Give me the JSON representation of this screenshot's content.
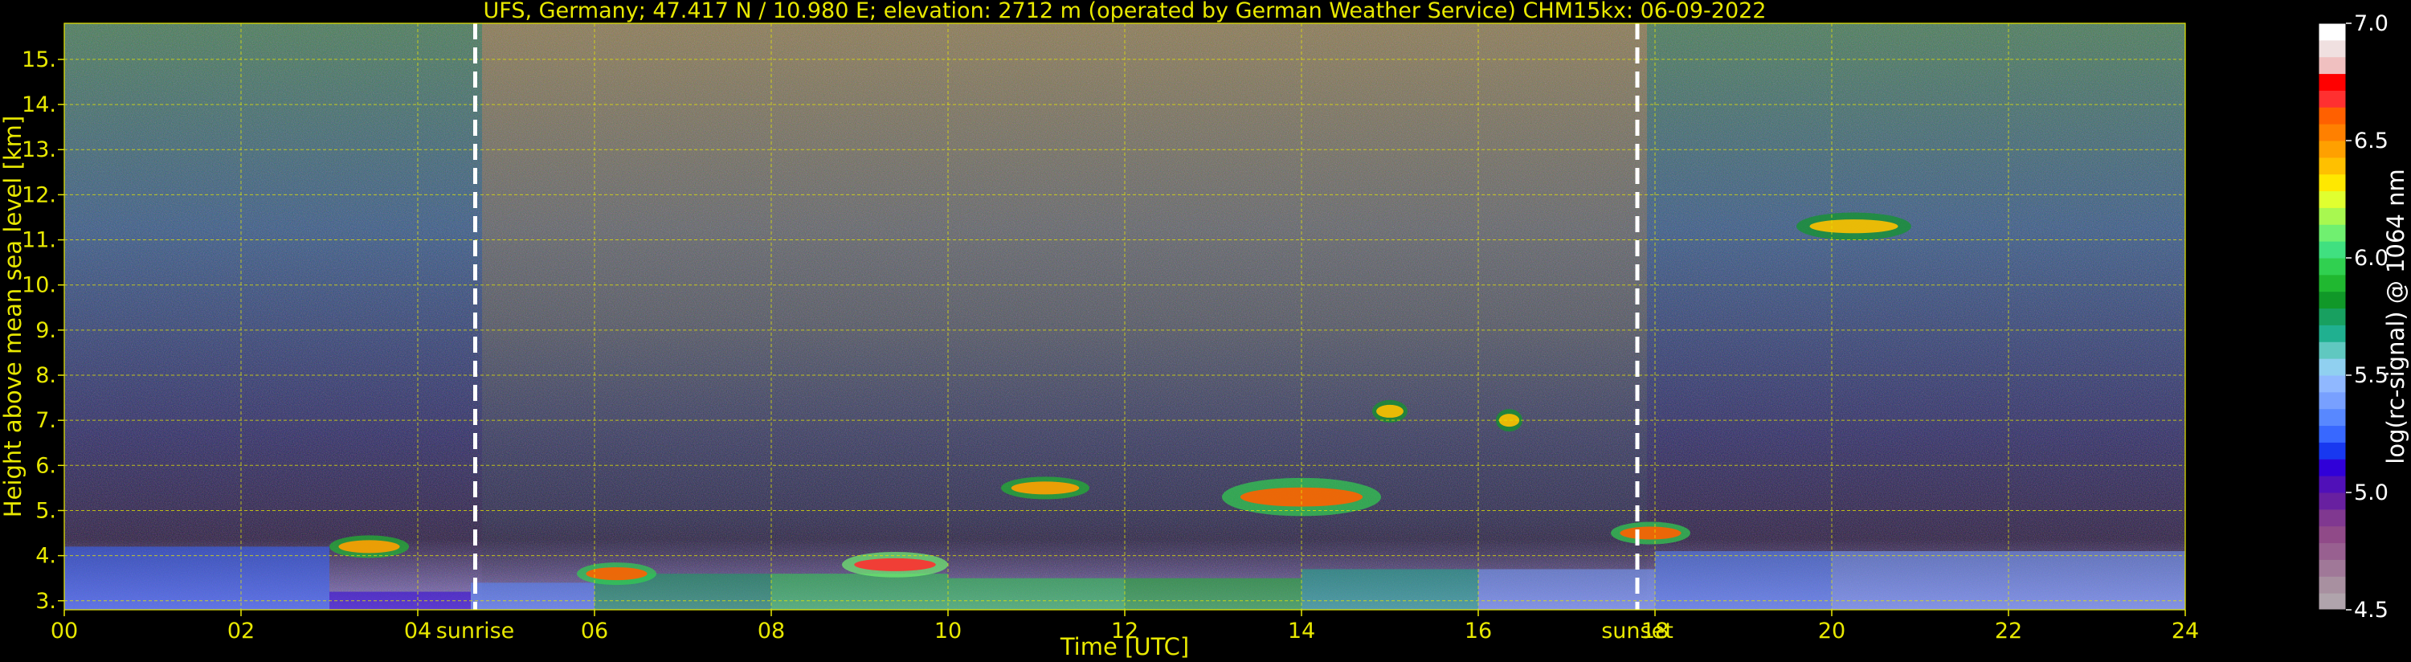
{
  "chart_data": {
    "type": "heatmap",
    "title": "UFS, Germany; 47.417 N / 10.980 E; elevation: 2712 m  (operated by German Weather Service)     CHM15kx: 06-09-2022",
    "xlabel": "Time [UTC]",
    "ylabel": "Height above mean sea level [km]",
    "xlim": [
      0,
      24
    ],
    "ylim": [
      2.8,
      15.8
    ],
    "x_ticks": [
      "00",
      "02",
      "04",
      "06",
      "08",
      "10",
      "12",
      "14",
      "16",
      "18",
      "20",
      "22",
      "24"
    ],
    "y_ticks": [
      "3.",
      "4.",
      "5.",
      "6.",
      "7.",
      "8.",
      "9.",
      "10.",
      "11.",
      "12.",
      "13.",
      "14.",
      "15."
    ],
    "grid": true,
    "markers": [
      {
        "label": "sunrise",
        "x": 4.65
      },
      {
        "label": "sunset",
        "x": 17.8
      }
    ],
    "colorbar": {
      "label": "log(rc-signal) @ 1064 nm",
      "range": [
        4.5,
        7.0
      ],
      "ticks": [
        "4.5",
        "5.0",
        "5.5",
        "6.0",
        "6.5",
        "7.0"
      ],
      "colors": [
        "#b0a4ac",
        "#a890a0",
        "#a07898",
        "#986090",
        "#904a88",
        "#803890",
        "#6820a0",
        "#5010b8",
        "#3000d8",
        "#1838f0",
        "#3868ff",
        "#5888ff",
        "#78a0ff",
        "#90b8ff",
        "#90d0f0",
        "#60c8c0",
        "#20b090",
        "#18a060",
        "#109828",
        "#20b830",
        "#30d050",
        "#40e080",
        "#70f070",
        "#a8f850",
        "#e0ff30",
        "#ffe800",
        "#ffc000",
        "#ffa000",
        "#ff8000",
        "#ff6000",
        "#ff3030",
        "#ff0000",
        "#f0c0c0",
        "#f0e0e0",
        "#ffffff"
      ]
    },
    "cloud_layers": [
      {
        "x_start": 10.6,
        "x_end": 11.6,
        "y_center": 5.5,
        "intensity": 6.5
      },
      {
        "x_start": 13.1,
        "x_end": 14.9,
        "y_center": 5.3,
        "intensity": 6.6
      },
      {
        "x_start": 14.8,
        "x_end": 15.2,
        "y_center": 7.2,
        "intensity": 6.4
      },
      {
        "x_start": 16.2,
        "x_end": 16.5,
        "y_center": 7.0,
        "intensity": 6.4
      },
      {
        "x_start": 19.6,
        "x_end": 20.9,
        "y_center": 11.3,
        "intensity": 6.4
      },
      {
        "x_start": 3.0,
        "x_end": 3.9,
        "y_center": 4.2,
        "intensity": 6.5
      },
      {
        "x_start": 5.8,
        "x_end": 6.7,
        "y_center": 3.6,
        "intensity": 6.6
      },
      {
        "x_start": 8.8,
        "x_end": 10.0,
        "y_center": 3.8,
        "intensity": 6.7
      },
      {
        "x_start": 17.5,
        "x_end": 18.4,
        "y_center": 4.5,
        "intensity": 6.6
      }
    ]
  }
}
